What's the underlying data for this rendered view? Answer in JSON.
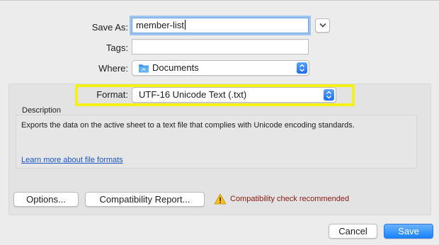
{
  "save_as": {
    "label": "Save As:",
    "value": "member-list"
  },
  "tags": {
    "label": "Tags:",
    "value": ""
  },
  "where": {
    "label": "Where:",
    "value": "Documents",
    "icon": "folder-icon",
    "folder_color": "#3f9bf0"
  },
  "format": {
    "label": "Format:",
    "value": "UTF-16 Unicode Text (.txt)",
    "highlight_color": "#f3f116"
  },
  "description": {
    "title": "Description",
    "text": "Exports the data on the active sheet to a text file that complies with Unicode encoding standards.",
    "link": "Learn more about file formats"
  },
  "options_button": "Options...",
  "compat_button": "Compatibility Report...",
  "compat_warning": {
    "icon": "warning-icon",
    "text": "Compatibility check recommended",
    "color": "#8a1a10"
  },
  "cancel_button": "Cancel",
  "save_button": "Save"
}
